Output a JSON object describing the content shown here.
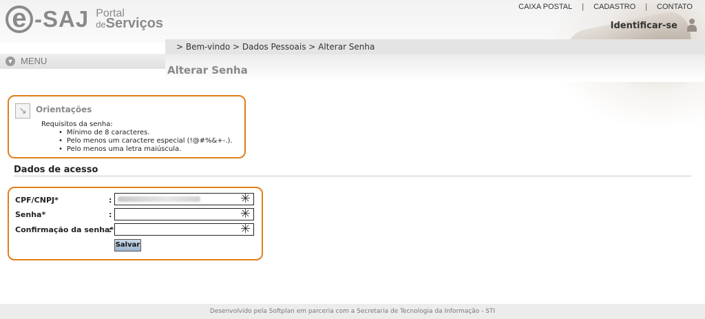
{
  "header": {
    "logo_e": "e",
    "logo_saj": "-SAJ",
    "logo_portal": "Portal",
    "logo_de": "de",
    "logo_servicos": "Serviços",
    "identificar": "Identificar-se"
  },
  "topnav": {
    "items": [
      "CAIXA POSTAL",
      "CADASTRO",
      "CONTATO"
    ],
    "separator": "|"
  },
  "breadcrumb": {
    "text": "> Bem-vindo > Dados Pessoais > Alterar Senha"
  },
  "menu": {
    "label": "MENU"
  },
  "page": {
    "title": "Alterar Senha"
  },
  "orientacoes": {
    "title": "Orientações",
    "requirements_label": "Requisitos da senha:",
    "items": [
      "Mínimo de 8 caracteres.",
      "Pelo menos um caractere especial (!@#%&+-.).",
      "Pelo menos uma letra maiúscula."
    ]
  },
  "section": {
    "title": "Dados de acesso"
  },
  "form": {
    "cpf_label": "CPF/CNPJ*",
    "senha_label": "Senha*",
    "confirm_label": "Confirmação da senha*",
    "colon": ":",
    "required_mark": "✳",
    "save_label": "Salvar"
  },
  "footer": {
    "text": "Desenvolvido pela Softplan em parceria com a Secretaria de Tecnologia da Informação - STI"
  },
  "colors": {
    "accent_orange": "#e07d1a",
    "button_blue": "#9db6d0",
    "gray_text": "#888888"
  }
}
